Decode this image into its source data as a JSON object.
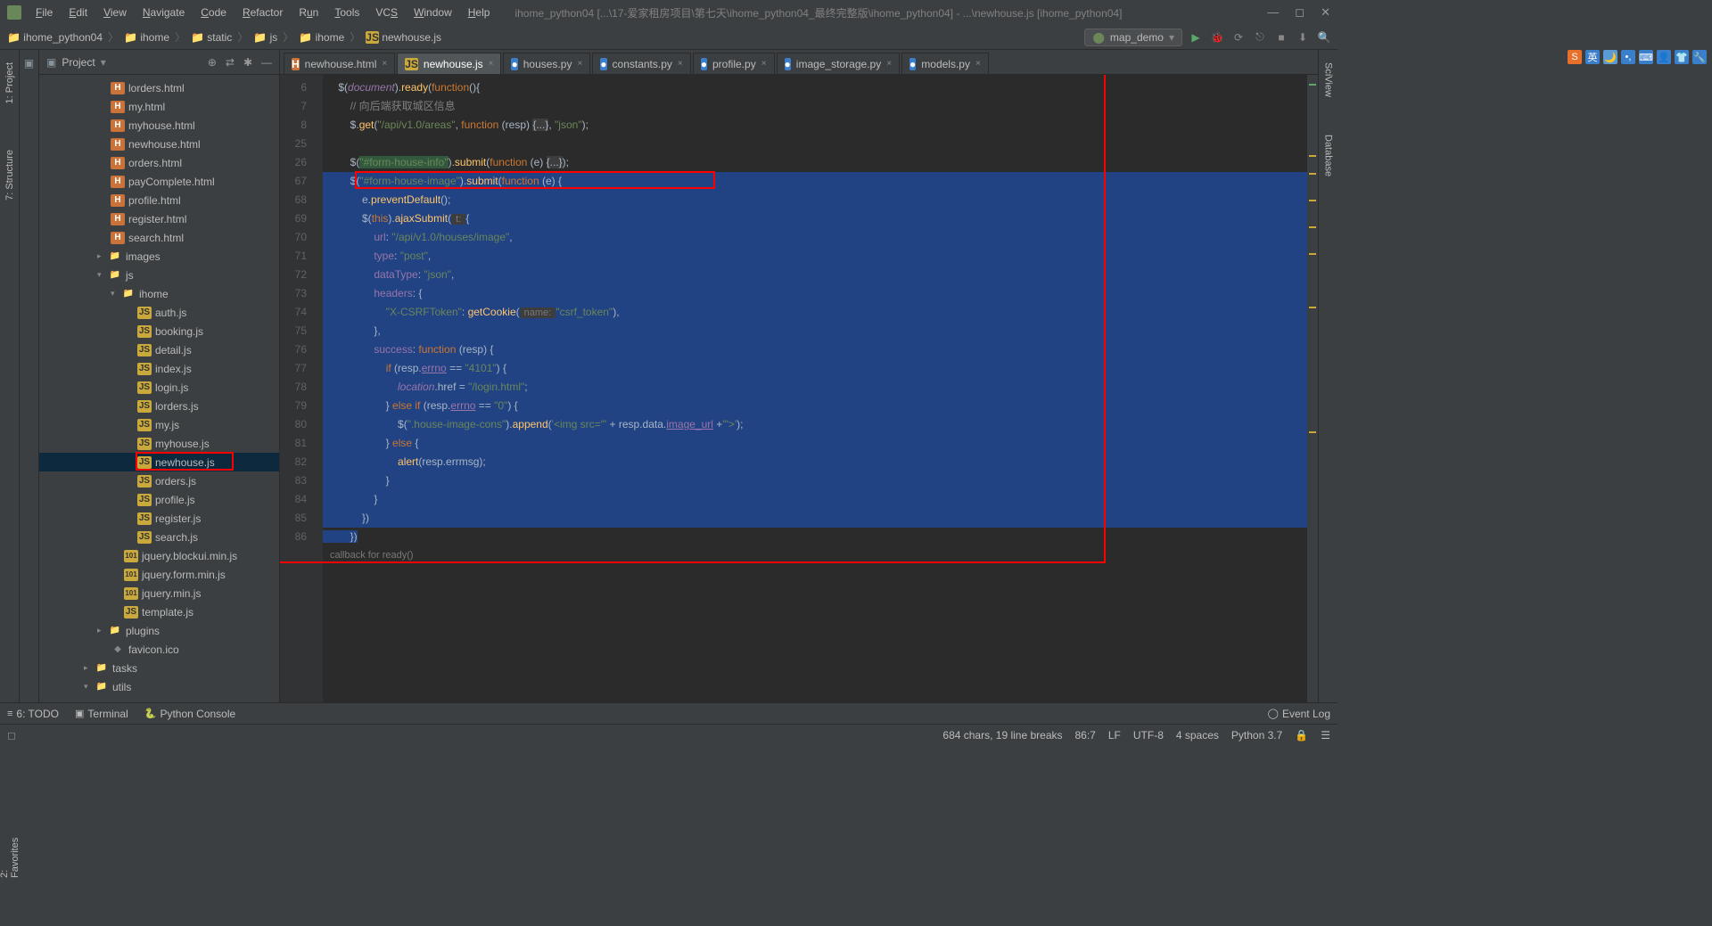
{
  "window": {
    "title": "ihome_python04 [...\\17-爱家租房项目\\第七天\\ihome_python04_最终完整版\\ihome_python04] - ...\\newhouse.js [ihome_python04]"
  },
  "menu": {
    "file": "File",
    "edit": "Edit",
    "view": "View",
    "navigate": "Navigate",
    "code": "Code",
    "refactor": "Refactor",
    "run": "Run",
    "tools": "Tools",
    "vcs": "VCS",
    "window": "Window",
    "help": "Help"
  },
  "breadcrumbs": {
    "b0": "ihome_python04",
    "b1": "ihome",
    "b2": "static",
    "b3": "js",
    "b4": "ihome",
    "b5": "newhouse.js"
  },
  "run_config": "map_demo",
  "left_tools": {
    "proj": "1: Project",
    "struct": "7: Structure",
    "fav": "2: Favorites"
  },
  "right_tools": {
    "sci": "SciView",
    "db": "Database"
  },
  "project_header": "Project",
  "tree": {
    "lorders_html": "lorders.html",
    "my_html": "my.html",
    "myhouse_html": "myhouse.html",
    "newhouse_html": "newhouse.html",
    "orders_html": "orders.html",
    "paycomplete_html": "payComplete.html",
    "profile_html": "profile.html",
    "register_html": "register.html",
    "search_html": "search.html",
    "images": "images",
    "js": "js",
    "ihome": "ihome",
    "auth_js": "auth.js",
    "booking_js": "booking.js",
    "detail_js": "detail.js",
    "index_js": "index.js",
    "login_js": "login.js",
    "lorders_js": "lorders.js",
    "my_js": "my.js",
    "myhouse_js": "myhouse.js",
    "newhouse_js": "newhouse.js",
    "orders_js": "orders.js",
    "profile_js": "profile.js",
    "register_js": "register.js",
    "search_js": "search.js",
    "jq_blockui": "jquery.blockui.min.js",
    "jq_form": "jquery.form.min.js",
    "jq_min": "jquery.min.js",
    "template_js": "template.js",
    "plugins": "plugins",
    "favicon": "favicon.ico",
    "tasks": "tasks",
    "utils": "utils"
  },
  "tabs": {
    "t0": "newhouse.html",
    "t1": "newhouse.js",
    "t2": "houses.py",
    "t3": "constants.py",
    "t4": "profile.py",
    "t5": "image_storage.py",
    "t6": "models.py"
  },
  "code": {
    "gutter": [
      "6",
      "7",
      "8",
      "25",
      "26",
      "67",
      "68",
      "69",
      "70",
      "71",
      "72",
      "73",
      "74",
      "75",
      "76",
      "77",
      "78",
      "79",
      "80",
      "81",
      "82",
      "83",
      "84",
      "85",
      "86",
      ""
    ],
    "crumb": "callback for ready()",
    "l6_a": "$(",
    "l6_b": "document",
    "l6_c": ").",
    "l6_d": "ready",
    "l6_e": "(",
    "l6_f": "function",
    "l6_g": "(){",
    "l7": "        // 向后端获取城区信息",
    "l8_a": "        $.",
    "l8_b": "get",
    "l8_c": "(",
    "l8_d": "\"/api/v1.0/areas\"",
    "l8_e": ", ",
    "l8_f": "function ",
    "l8_g": "(resp) ",
    "l8_h": "{...}",
    "l8_i": ", ",
    "l8_j": "\"json\"",
    "l8_k": ");",
    "l26_a": "        $(",
    "l26_b": "\"#form-house-info\"",
    "l26_c": ").",
    "l26_d": "submit",
    "l26_e": "(",
    "l26_f": "function ",
    "l26_g": "(e) ",
    "l26_h": "{...}",
    "l26_i": ");",
    "l67_a": "        $(",
    "l67_b": "\"#form-house-image\"",
    "l67_c": ").",
    "l67_d": "submit",
    "l67_e": "(",
    "l67_f": "function ",
    "l67_g": "(e)",
    "l67_h": " {",
    "l68_a": "            e.",
    "l68_b": "preventDefault",
    "l68_c": "();",
    "l69_a": "            $(",
    "l69_b": "this",
    "l69_c": ").",
    "l69_d": "ajaxSubmit",
    "l69_e": "(",
    "l69_hint": " t: ",
    "l69_f": "{",
    "l70_a": "                ",
    "l70_b": "url",
    "l70_c": ": ",
    "l70_d": "\"/api/v1.0/houses/image\"",
    "l70_e": ",",
    "l71_a": "                ",
    "l71_b": "type",
    "l71_c": ": ",
    "l71_d": "\"post\"",
    "l71_e": ",",
    "l72_a": "                ",
    "l72_b": "dataType",
    "l72_c": ": ",
    "l72_d": "\"json\"",
    "l72_e": ",",
    "l73_a": "                ",
    "l73_b": "headers",
    "l73_c": ": {",
    "l74_a": "                    ",
    "l74_b": "\"X-CSRFToken\"",
    "l74_c": ": ",
    "l74_d": "getCookie",
    "l74_e": "(",
    "l74_hint": " name: ",
    "l74_f": "\"csrf_token\"",
    "l74_g": "),",
    "l75": "                },",
    "l76_a": "                ",
    "l76_b": "success",
    "l76_c": ": ",
    "l76_d": "function ",
    "l76_e": "(resp) {",
    "l77_a": "                    ",
    "l77_b": "if ",
    "l77_c": "(resp.",
    "l77_d": "errno",
    "l77_e": " == ",
    "l77_f": "\"4101\"",
    "l77_g": ") {",
    "l78_a": "                        ",
    "l78_b": "location",
    "l78_c": ".href = ",
    "l78_d": "\"/login.html\"",
    "l78_e": ";",
    "l79_a": "                    } ",
    "l79_b": "else if ",
    "l79_c": "(resp.",
    "l79_d": "errno",
    "l79_e": " == ",
    "l79_f": "\"0\"",
    "l79_g": ") {",
    "l80_a": "                        $(",
    "l80_b": "\".house-image-cons\"",
    "l80_c": ").",
    "l80_d": "append",
    "l80_e": "(",
    "l80_f": "'<img src=\"'",
    "l80_g": " + resp.data.",
    "l80_h": "image_url",
    "l80_i": " +",
    "l80_j": "'\">'",
    "l80_k": ");",
    "l81_a": "                    } ",
    "l81_b": "else ",
    "l81_c": "{",
    "l82_a": "                        ",
    "l82_b": "alert",
    "l82_c": "(resp.errmsg);",
    "l83": "                    }",
    "l84": "                }",
    "l85": "            })",
    "l86": "        })"
  },
  "bottom": {
    "todo": "6: TODO",
    "terminal": "Terminal",
    "pyconsole": "Python Console",
    "eventlog": "Event Log"
  },
  "status": {
    "sel": "684 chars, 19 line breaks",
    "pos": "86:7",
    "le": "LF",
    "enc": "UTF-8",
    "indent": "4 spaces",
    "py": "Python 3.7"
  }
}
